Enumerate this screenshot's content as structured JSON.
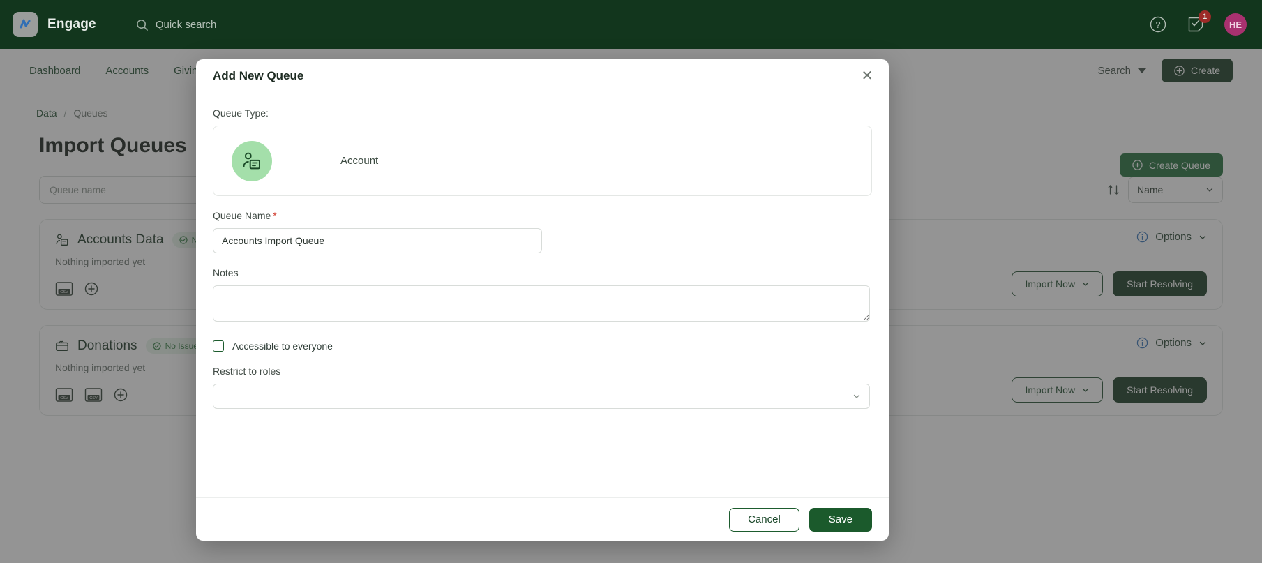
{
  "topbar": {
    "brand": "Engage",
    "logo_icon": "engage-logo-icon",
    "search_placeholder": "Quick search",
    "search_icon": "search-icon",
    "help_icon": "help-circle-icon",
    "tasks_icon": "task-note-icon",
    "tasks_badge": "1",
    "avatar_initials": "HE",
    "bg_color": "#12361d",
    "avatar_color": "#a8316f",
    "badge_color": "#b02a2a"
  },
  "nav": {
    "items": [
      {
        "label": "Dashboard"
      },
      {
        "label": "Accounts"
      },
      {
        "label": "Giving"
      }
    ],
    "search_label": "Search",
    "create_label": "Create",
    "create_icon": "plus-circle-icon",
    "chevron_icon": "chevron-down-icon"
  },
  "page": {
    "breadcrumb": {
      "root": "Data",
      "separator": "/",
      "current": "Queues"
    },
    "title": "Import Queues",
    "create_queue_label": "Create Queue",
    "create_queue_icon": "plus-circle-icon",
    "search_placeholder": "Queue name",
    "sort_icon": "sort-icon",
    "sort_value": "Name",
    "queues": [
      {
        "name": "Accounts Data",
        "icon": "account-card-icon",
        "status": "No Issues",
        "status_icon": "check-circle-icon",
        "subtitle": "Nothing imported yet",
        "file_icons": [
          "csv-file-icon",
          "add-circle-icon"
        ],
        "options_label": "Options",
        "options_icon": "info-circle-icon",
        "import_label": "Import Now",
        "resolve_label": "Start Resolving"
      },
      {
        "name": "Donations",
        "icon": "donation-icon",
        "status": "No Issues",
        "status_icon": "check-circle-icon",
        "subtitle": "Nothing imported yet",
        "file_icons": [
          "csv-file-icon",
          "csv-file-icon",
          "add-circle-icon"
        ],
        "options_label": "Options",
        "options_icon": "info-circle-icon",
        "import_label": "Import Now",
        "resolve_label": "Start Resolving"
      }
    ]
  },
  "modal": {
    "title": "Add New Queue",
    "close_icon": "close-icon",
    "queue_type_label": "Queue Type:",
    "queue_type": {
      "name": "Account",
      "icon": "account-card-icon",
      "icon_bg": "#a4dfaa"
    },
    "queue_name_label": "Queue Name",
    "queue_name_required": "*",
    "queue_name_value": "Accounts Import Queue",
    "notes_label": "Notes",
    "notes_value": "",
    "notes_placeholder": "",
    "accessible_label": "Accessible to everyone",
    "accessible_checked": false,
    "restrict_label": "Restrict to roles",
    "restrict_value": "",
    "restrict_chevron_icon": "chevron-down-icon",
    "cancel_label": "Cancel",
    "save_label": "Save"
  }
}
